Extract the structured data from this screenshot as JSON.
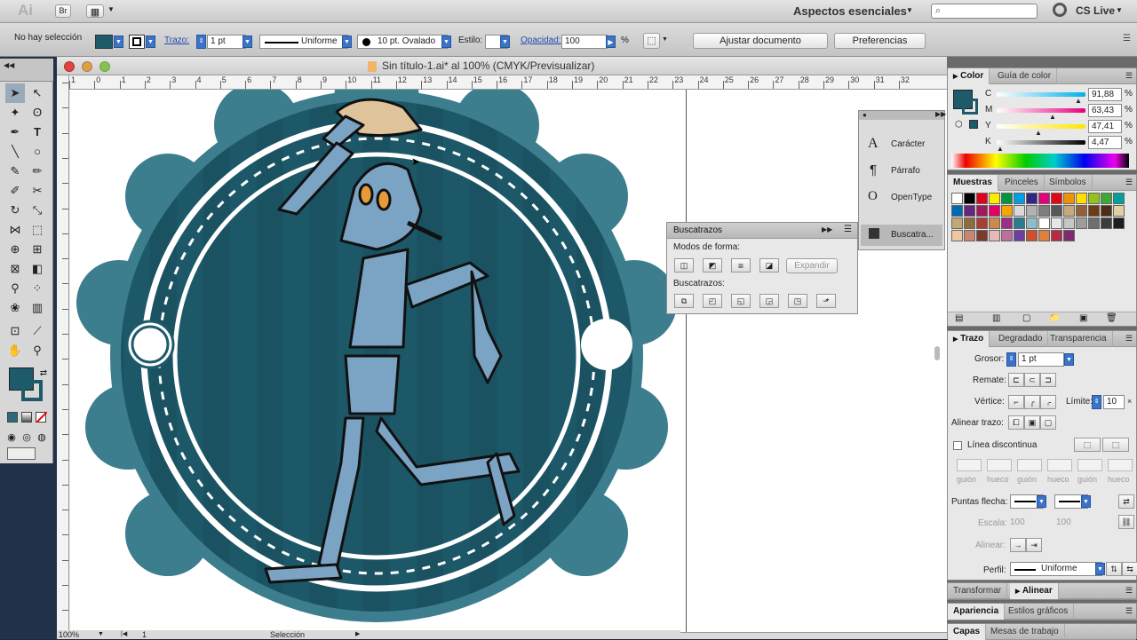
{
  "app": {
    "logo": "Ai",
    "bridge": "Br",
    "workspace": "Aspectos esenciales",
    "cs_live": "CS Live"
  },
  "control": {
    "selection_status": "No hay selección",
    "stroke_label": "Trazo:",
    "stroke_value": "1 pt",
    "stroke_profile": "Uniforme",
    "brush": "10 pt. Ovalado",
    "style_label": "Estilo:",
    "opacity_label": "Opacidad:",
    "opacity_value": "100",
    "opacity_unit": "%",
    "adjust_doc": "Ajustar documento",
    "preferences": "Preferencias"
  },
  "document": {
    "title": "Sin título-1.ai* al 100% (CMYK/Previsualizar)",
    "ruler_ticks": [
      "1",
      "0",
      "1",
      "2",
      "3",
      "4",
      "5",
      "6",
      "7",
      "8",
      "9",
      "10",
      "11",
      "12",
      "13",
      "14",
      "15",
      "16",
      "17",
      "18",
      "19",
      "20",
      "21",
      "22",
      "23",
      "24",
      "25",
      "26",
      "27",
      "28",
      "29",
      "30",
      "31",
      "32"
    ],
    "zoom": "100%",
    "page": "1",
    "status_tool": "Selección"
  },
  "pathfinder": {
    "title": "Buscatrazos",
    "shape_modes": "Modos de forma:",
    "expand": "Expandir",
    "pathfinders": "Buscatrazos:"
  },
  "mini_panel": {
    "items": [
      "Carácter",
      "Párrafo",
      "OpenType",
      "Buscatra..."
    ]
  },
  "color": {
    "tab1": "Color",
    "tab2": "Guía de color",
    "channels": [
      {
        "name": "C",
        "value": "91,88",
        "level": 0.92
      },
      {
        "name": "M",
        "value": "63,43",
        "level": 0.63
      },
      {
        "name": "Y",
        "value": "47,41",
        "level": 0.47
      },
      {
        "name": "K",
        "value": "4,47",
        "level": 0.04
      }
    ],
    "fill": "#1d5a6a"
  },
  "swatches": {
    "tabs": [
      "Muestras",
      "Pinceles",
      "Símbolos"
    ],
    "colors": [
      "#ffffff",
      "#000000",
      "#e2001a",
      "#ffed00",
      "#00963f",
      "#009fe3",
      "#312783",
      "#e6007e",
      "#e30613",
      "#f39200",
      "#ffde00",
      "#95c11f",
      "#3aaa35",
      "#00a19a",
      "#0069b4",
      "#662483",
      "#a2195b",
      "#e50064",
      "#f7a600",
      "#d9d9d9",
      "#b2b2b2",
      "#7e7e7e",
      "#575756",
      "#c9a77c",
      "#936037",
      "#6d3c15",
      "#4c2e18",
      "#dfd0a5",
      "#c2a877",
      "#8e6c3c",
      "#aa3d36",
      "#cc8a4a",
      "#9b2e85",
      "#2a7d8c",
      "#8bbec8",
      "#ffffff",
      "#e7e7e7",
      "#c6c6c6",
      "#9d9d9c",
      "#706f6f",
      "#3c3c3b",
      "#1d1d1b",
      "#f0c7a1",
      "#c8856f",
      "#7a3b2e",
      "#e6b9b8",
      "#bd6f9e",
      "#6f3fa0",
      "#d14f2b",
      "#e07e3c",
      "#b62c45",
      "#7f2a6e"
    ]
  },
  "stroke": {
    "tabs": [
      "Trazo",
      "Degradado",
      "Transparencia"
    ],
    "weight_label": "Grosor:",
    "weight": "1 pt",
    "cap_label": "Remate:",
    "corner_label": "Vértice:",
    "limit_label": "Límite:",
    "limit": "10",
    "align_label": "Alinear trazo:",
    "dashed": "Línea discontinua",
    "dash_labels": [
      "guión",
      "hueco",
      "guión",
      "hueco",
      "guión",
      "hueco"
    ],
    "arrows_label": "Puntas flecha:",
    "scale_label": "Escala:",
    "scale1": "100",
    "scale2": "100",
    "align2_label": "Alinear:",
    "profile_label": "Perfil:",
    "profile": "Uniforme"
  },
  "bottom_tabs": {
    "row1": [
      "Transformar",
      "Alinear"
    ],
    "row2": [
      "Apariencia",
      "Estilos gráficos"
    ],
    "row3": [
      "Capas",
      "Mesas de trabajo"
    ]
  },
  "artwork": {
    "badge_color": "#1d5a6a",
    "badge_ring": "#3c7d8e",
    "robot_color": "#7ba3c4"
  }
}
